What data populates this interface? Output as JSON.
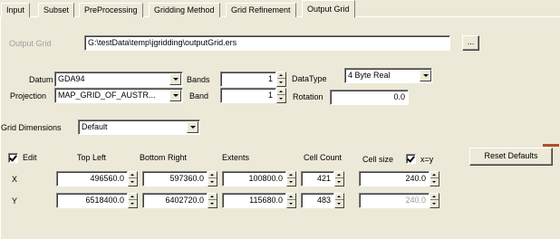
{
  "tabs": [
    {
      "label": "Input"
    },
    {
      "label": "Subset"
    },
    {
      "label": "PreProcessing"
    },
    {
      "label": "Gridding Method"
    },
    {
      "label": "Grid Refinement"
    },
    {
      "label": "Output Grid",
      "active": true
    }
  ],
  "output": {
    "label": "Output Grid",
    "path": "G:\\testData\\temp\\jgridding\\outputGrid.ers",
    "browse_label": "..."
  },
  "datum": {
    "label": "Datum",
    "value": "GDA94"
  },
  "projection": {
    "label": "Projection",
    "value": "MAP_GRID_OF_AUSTR..."
  },
  "bands": {
    "label": "Bands",
    "value": "1"
  },
  "band": {
    "label": "Band",
    "value": "1"
  },
  "datatype": {
    "label": "DataType",
    "value": "4 Byte Real"
  },
  "rotation": {
    "label": "Rotation",
    "value": "0.0"
  },
  "grid_dimensions": {
    "label": "Grid Dimensions",
    "value": "Default"
  },
  "edit": {
    "label": "Edit",
    "checked": true
  },
  "headers": {
    "top_left": "Top Left",
    "bottom_right": "Bottom Right",
    "extents": "Extents",
    "cell_count": "Cell Count",
    "cell_size": "Cell size",
    "xy_label": "x=y"
  },
  "xy_checked": true,
  "reset_label": "Reset Defaults",
  "rows": [
    {
      "label": "X",
      "top_left": "496560.0",
      "bottom_right": "597360.0",
      "extents": "100800.0",
      "cell_count": "421",
      "cell_size": "240.0"
    },
    {
      "label": "Y",
      "top_left": "6518400.0",
      "bottom_right": "6402720.0",
      "extents": "115680.0",
      "cell_count": "483",
      "cell_size": "240.0"
    }
  ]
}
